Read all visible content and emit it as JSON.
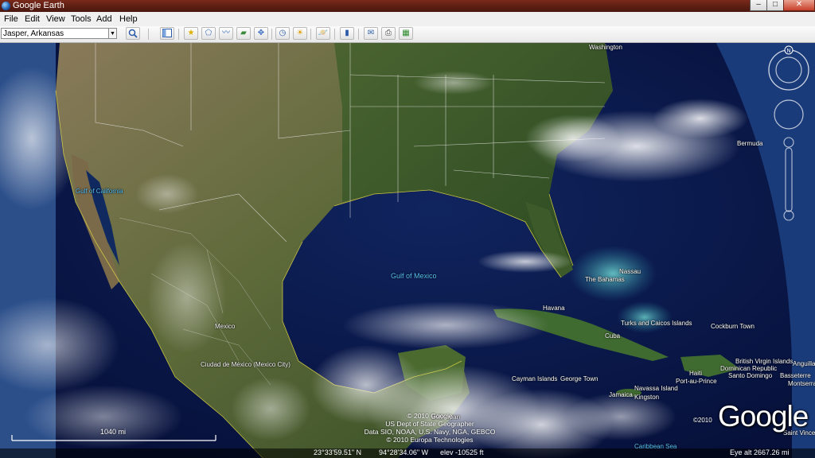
{
  "window": {
    "title": "Google Earth",
    "minimize": "–",
    "maximize": "□",
    "close": "✕"
  },
  "menu": [
    "File",
    "Edit",
    "View",
    "Tools",
    "Add",
    "Help"
  ],
  "search": {
    "value": "Jasper, Arkansas"
  },
  "toolbar_icons": [
    "sidebar-toggle-icon",
    "placemark-icon",
    "polygon-icon",
    "path-icon",
    "image-overlay-icon",
    "record-tour-icon",
    "historical-imagery-icon",
    "sunlight-icon",
    "planet-switch-icon",
    "ruler-icon",
    "email-icon",
    "print-icon",
    "view-in-maps-icon"
  ],
  "map_labels": {
    "washington": "Washington",
    "bermuda": "Bermuda",
    "gulf_of_california": "Gulf of California",
    "gulf_of_mexico": "Gulf of Mexico",
    "nassau": "Nassau",
    "the_bahamas": "The Bahamas",
    "havana": "Havana",
    "cuba": "Cuba",
    "turks_caicos": "Turks and Caicos Islands",
    "cockburn_town": "Cockburn Town",
    "mexico": "Mexico",
    "ciudad_de_mexico": "Ciudad de México (Mexico City)",
    "cayman": "Cayman Islands",
    "george_town": "George Town",
    "british_virgin": "British Virgin Islands",
    "dominican": "Dominican Republic",
    "anguilla": "Anguilla",
    "haiti": "Haiti",
    "port_au_prince": "Port-au-Prince",
    "santo_domingo": "Santo Domingo",
    "basseterre": "Basseterre",
    "montserrat": "Montserrat",
    "jamaica": "Jamaica",
    "kingston": "Kingston",
    "navassa": "Navassa Island",
    "belmopan": "Belmopan",
    "caribbean_sea": "Caribbean Sea",
    "saint_vincent": "Saint Vincent"
  },
  "copyright_lines": [
    "© 2010 Google",
    "US Dept of State Geographer",
    "Data SIO, NOAA, U.S. Navy, NGA, GEBCO",
    "© 2010 Europa Technologies"
  ],
  "brand": {
    "logo": "Google",
    "year": "©2010"
  },
  "scale_label": "1040 mi",
  "compass": {
    "north": "N"
  },
  "status": {
    "lat": "23°33'59.51\" N",
    "lon": "94°28'34.06\" W",
    "elev": "elev -10525 ft",
    "eye": "Eye alt 2667.26 mi"
  }
}
